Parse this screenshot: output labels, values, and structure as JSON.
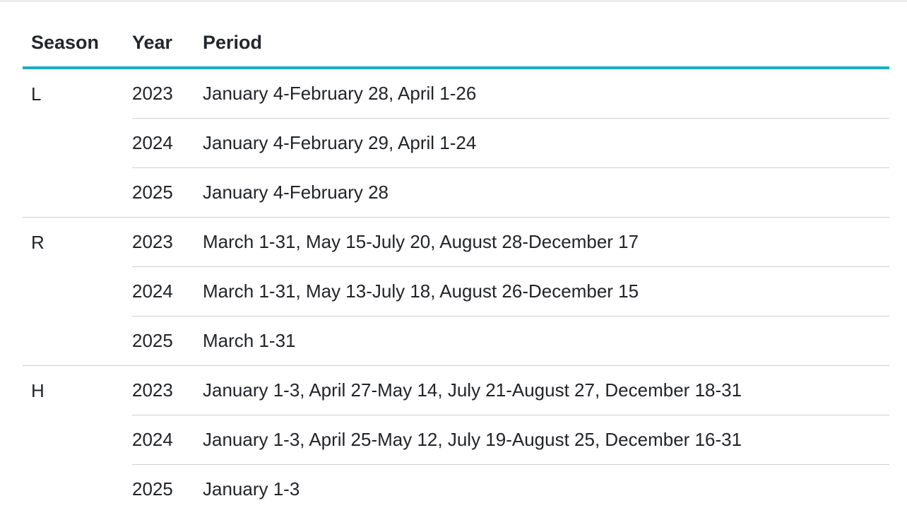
{
  "table": {
    "headers": {
      "season": "Season",
      "year": "Year",
      "period": "Period"
    },
    "groups": [
      {
        "season": "L",
        "rows": [
          {
            "year": "2023",
            "period": "January 4-February 28, April 1-26"
          },
          {
            "year": "2024",
            "period": "January 4-February 29, April 1-24"
          },
          {
            "year": "2025",
            "period": "January 4-February 28"
          }
        ]
      },
      {
        "season": "R",
        "rows": [
          {
            "year": "2023",
            "period": "March 1-31, May 15-July 20, August 28-December 17"
          },
          {
            "year": "2024",
            "period": "March 1-31, May 13-July 18, August 26-December 15"
          },
          {
            "year": "2025",
            "period": "March 1-31"
          }
        ]
      },
      {
        "season": "H",
        "rows": [
          {
            "year": "2023",
            "period": "January 1-3, April 27-May 14, July 21-August 27, December 18-31"
          },
          {
            "year": "2024",
            "period": "January 1-3, April 25-May 12, July 19-August 25, December 16-31"
          },
          {
            "year": "2025",
            "period": "January 1-3"
          }
        ]
      }
    ]
  },
  "colors": {
    "accent": "#1aa9d4",
    "divider": "#d0d0d0",
    "text": "#222428"
  }
}
